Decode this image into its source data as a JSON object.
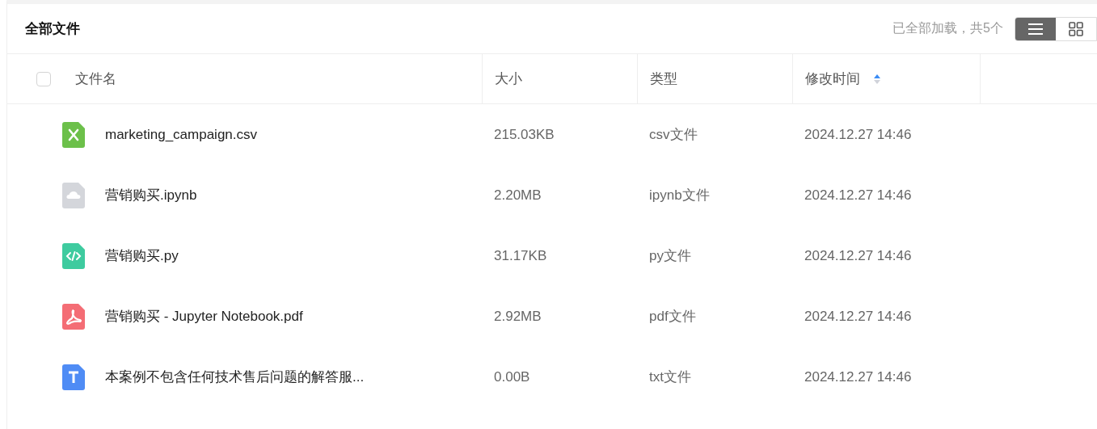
{
  "title": "全部文件",
  "load_status": "已全部加载，共5个",
  "view_toggle": [
    {
      "kind": "list",
      "selected": true
    },
    {
      "kind": "grid",
      "selected": false
    }
  ],
  "table": {
    "select_all": {
      "checked": false
    },
    "columns": [
      {
        "label": "文件名"
      },
      {
        "label": "大小"
      },
      {
        "label": "类型"
      },
      {
        "label": "修改时间",
        "sort_ascending": true
      }
    ],
    "rows": [
      {
        "kind": "csv",
        "name": "marketing_campaign.csv",
        "size": "215.03KB",
        "type": "csv文件",
        "modified": "2024.12.27 14:46"
      },
      {
        "kind": "ipynb",
        "name": "营销购买.ipynb",
        "size": "2.20MB",
        "type": "ipynb文件",
        "modified": "2024.12.27 14:46"
      },
      {
        "kind": "py",
        "name": "营销购买.py",
        "size": "31.17KB",
        "type": "py文件",
        "modified": "2024.12.27 14:46"
      },
      {
        "kind": "pdf",
        "name": "营销购买 - Jupyter Notebook.pdf",
        "size": "2.92MB",
        "type": "pdf文件",
        "modified": "2024.12.27 14:46"
      },
      {
        "kind": "txt",
        "name": "本案例不包含任何技术售后问题的解答服...",
        "size": "0.00B",
        "type": "txt文件",
        "modified": "2024.12.27 14:46"
      }
    ]
  }
}
